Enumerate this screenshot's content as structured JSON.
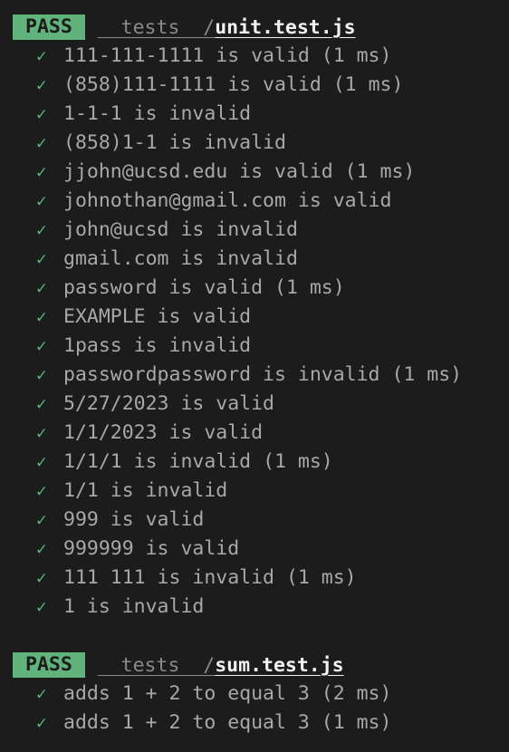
{
  "colors": {
    "background": "#1c1c1c",
    "pass_badge": "#5fb37b",
    "check": "#5fb37b",
    "text": "#a8a8a8",
    "filename": "#f2f2f2"
  },
  "suites": [
    {
      "status": "PASS",
      "path_dir": "__tests__/",
      "path_file": "unit.test.js",
      "tests": [
        {
          "icon": "check-icon",
          "mark": "✓",
          "name": "111-111-1111 is valid",
          "time": "(1 ms)"
        },
        {
          "icon": "check-icon",
          "mark": "✓",
          "name": "(858)111-1111 is valid",
          "time": "(1 ms)"
        },
        {
          "icon": "check-icon",
          "mark": "✓",
          "name": "1-1-1 is invalid",
          "time": ""
        },
        {
          "icon": "check-icon",
          "mark": "✓",
          "name": "(858)1-1 is invalid",
          "time": ""
        },
        {
          "icon": "check-icon",
          "mark": "✓",
          "name": "jjohn@ucsd.edu is valid",
          "time": "(1 ms)"
        },
        {
          "icon": "check-icon",
          "mark": "✓",
          "name": "johnothan@gmail.com is valid",
          "time": ""
        },
        {
          "icon": "check-icon",
          "mark": "✓",
          "name": "john@ucsd is invalid",
          "time": ""
        },
        {
          "icon": "check-icon",
          "mark": "✓",
          "name": "gmail.com is invalid",
          "time": ""
        },
        {
          "icon": "check-icon",
          "mark": "✓",
          "name": "password is valid",
          "time": "(1 ms)"
        },
        {
          "icon": "check-icon",
          "mark": "✓",
          "name": "EXAMPLE is valid",
          "time": ""
        },
        {
          "icon": "check-icon",
          "mark": "✓",
          "name": "1pass is invalid",
          "time": ""
        },
        {
          "icon": "check-icon",
          "mark": "✓",
          "name": "passwordpassword is invalid",
          "time": "(1 ms)"
        },
        {
          "icon": "check-icon",
          "mark": "✓",
          "name": "5/27/2023 is valid",
          "time": ""
        },
        {
          "icon": "check-icon",
          "mark": "✓",
          "name": "1/1/2023 is valid",
          "time": ""
        },
        {
          "icon": "check-icon",
          "mark": "✓",
          "name": "1/1/1 is invalid",
          "time": "(1 ms)"
        },
        {
          "icon": "check-icon",
          "mark": "✓",
          "name": "1/1 is invalid",
          "time": ""
        },
        {
          "icon": "check-icon",
          "mark": "✓",
          "name": "999 is valid",
          "time": ""
        },
        {
          "icon": "check-icon",
          "mark": "✓",
          "name": "999999 is valid",
          "time": ""
        },
        {
          "icon": "check-icon",
          "mark": "✓",
          "name": "111 111 is invalid",
          "time": "(1 ms)"
        },
        {
          "icon": "check-icon",
          "mark": "✓",
          "name": "1 is invalid",
          "time": ""
        }
      ]
    },
    {
      "status": "PASS",
      "path_dir": "__tests__/",
      "path_file": "sum.test.js",
      "tests": [
        {
          "icon": "check-icon",
          "mark": "✓",
          "name": "adds 1 + 2 to equal 3",
          "time": "(2 ms)"
        },
        {
          "icon": "check-icon",
          "mark": "✓",
          "name": "adds 1 + 2 to equal 3",
          "time": "(1 ms)"
        }
      ]
    }
  ]
}
